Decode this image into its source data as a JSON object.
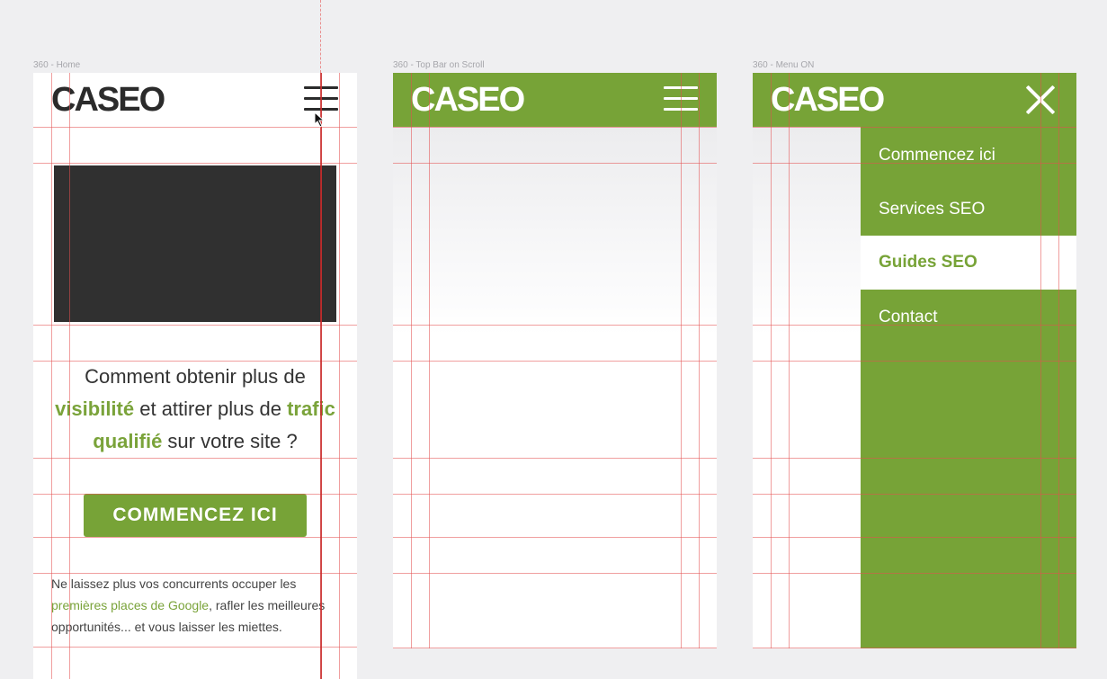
{
  "artboards": [
    {
      "label": "360 - Home"
    },
    {
      "label": "360 - Top Bar on Scroll"
    },
    {
      "label": "360 - Menu ON"
    }
  ],
  "logo_text": "CASEO",
  "home": {
    "headline_part1": "Comment obtenir plus de ",
    "headline_highlight1": "visibilité",
    "headline_part2": " et attirer plus de ",
    "headline_highlight2": "trafic qualifié",
    "headline_part3": " sur votre site ?",
    "cta_label": "COMMENCEZ ICI",
    "body_part1": "Ne laissez plus vos concurrents occuper les ",
    "body_highlight": "premières places de Google",
    "body_part2": ", rafler les meilleures opportunités... et vous laisser les miettes."
  },
  "menu": {
    "items": [
      {
        "label": "Commencez ici",
        "active": false
      },
      {
        "label": "Services SEO",
        "active": false
      },
      {
        "label": "Guides SEO",
        "active": true
      },
      {
        "label": "Contact",
        "active": false
      }
    ]
  },
  "icons": {
    "menu": "hamburger-menu-icon",
    "close": "close-icon",
    "cursor": "mouse-pointer-icon"
  },
  "colors": {
    "brand_green": "#77a337",
    "text_green": "#7aa33a",
    "image_placeholder": "#303030",
    "guide_lines": "#e45050",
    "canvas_bg": "#efeff1"
  }
}
